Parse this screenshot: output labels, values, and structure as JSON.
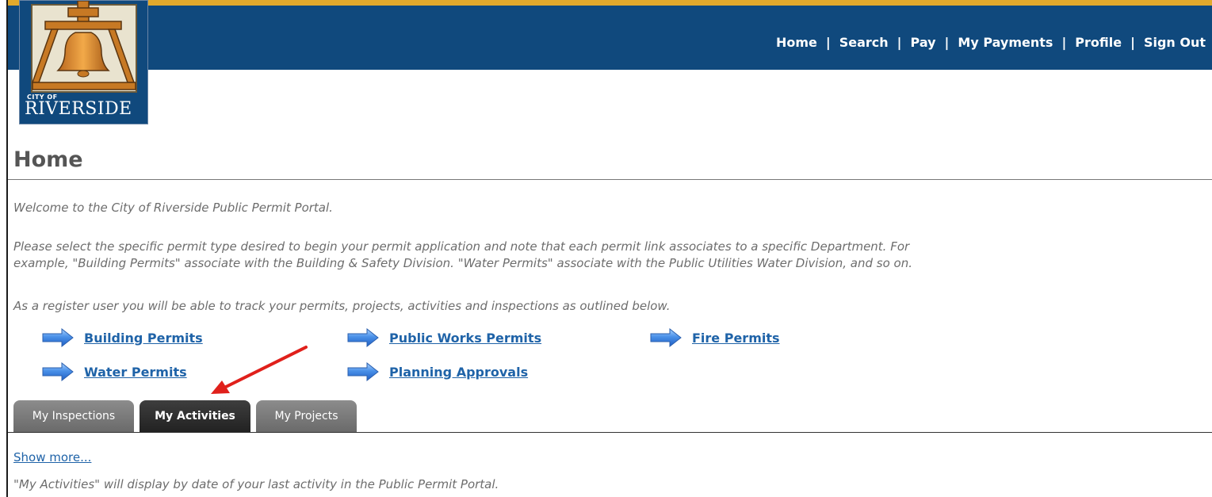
{
  "header": {
    "logo": {
      "small_text": "CITY OF",
      "big_text": "RIVERSIDE",
      "icon": "bell-icon"
    },
    "nav": [
      {
        "label": "Home"
      },
      {
        "label": "Search"
      },
      {
        "label": "Pay"
      },
      {
        "label": "My Payments"
      },
      {
        "label": "Profile"
      },
      {
        "label": "Sign Out"
      }
    ],
    "separator": "|",
    "colors": {
      "gold": "#e2a92c",
      "blue": "#10497d"
    }
  },
  "main": {
    "title": "Home",
    "paragraphs": [
      "Welcome to the City of Riverside Public Permit Portal.",
      "Please select the specific permit type desired to begin your permit application and note that each permit link associates to a specific Department. For",
      "example, \"Building Permits\" associate with the Building & Safety Division. \"Water Permits\" associate with the Public Utilities Water Division, and so on.",
      "As a register user you will be able to track your permits, projects, activities and inspections as outlined below."
    ],
    "permit_links": [
      {
        "label": "Building Permits",
        "icon": "blue-arrow-icon"
      },
      {
        "label": "Public Works Permits",
        "icon": "blue-arrow-icon"
      },
      {
        "label": "Fire Permits",
        "icon": "blue-arrow-icon"
      },
      {
        "label": "Water Permits",
        "icon": "blue-arrow-icon"
      },
      {
        "label": "Planning Approvals",
        "icon": "blue-arrow-icon"
      }
    ],
    "tabs": [
      {
        "label": "My Inspections",
        "active": false
      },
      {
        "label": "My Activities",
        "active": true
      },
      {
        "label": "My Projects",
        "active": false
      }
    ],
    "show_more": "Show more...",
    "tab_description": "\"My Activities\" will display by date of your last activity in the Public Permit Portal.",
    "annotation": {
      "icon": "red-pointer-arrow-icon",
      "color": "#e0201b"
    }
  }
}
